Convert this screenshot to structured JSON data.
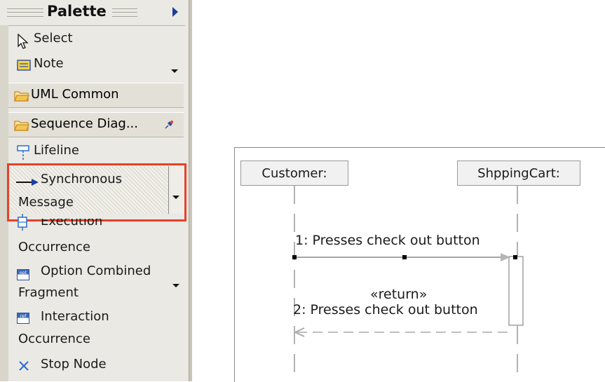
{
  "palette": {
    "title": "Palette",
    "items": {
      "select": "Select",
      "note": "Note",
      "uml_common": "UML Common",
      "sequence_diag": "Sequence Diag...",
      "lifeline": "Lifeline",
      "sync_line1": "Synchronous",
      "sync_line2": "Message",
      "exec_line1": "Execution",
      "exec_line2": "Occurrence",
      "opt_line1": "Option Combined",
      "opt_line2": "Fragment",
      "inter_line1": "Interaction",
      "inter_line2": "Occurrence",
      "stop_node": "Stop Node"
    },
    "icon_labels": {
      "opt": "opt",
      "ref": "ref"
    }
  },
  "diagram": {
    "lifeline1": "Customer:",
    "lifeline2": "ShppingCart:",
    "msg1": "1: Presses check out button",
    "return_stereotype": "«return»",
    "msg2": "2: Presses check out button"
  },
  "colors": {
    "palette_bg": "#ebe9e3",
    "highlight_border": "#e8402a",
    "message_arrow": "#1b3e9b",
    "folder_icon": "#e2a93b"
  }
}
